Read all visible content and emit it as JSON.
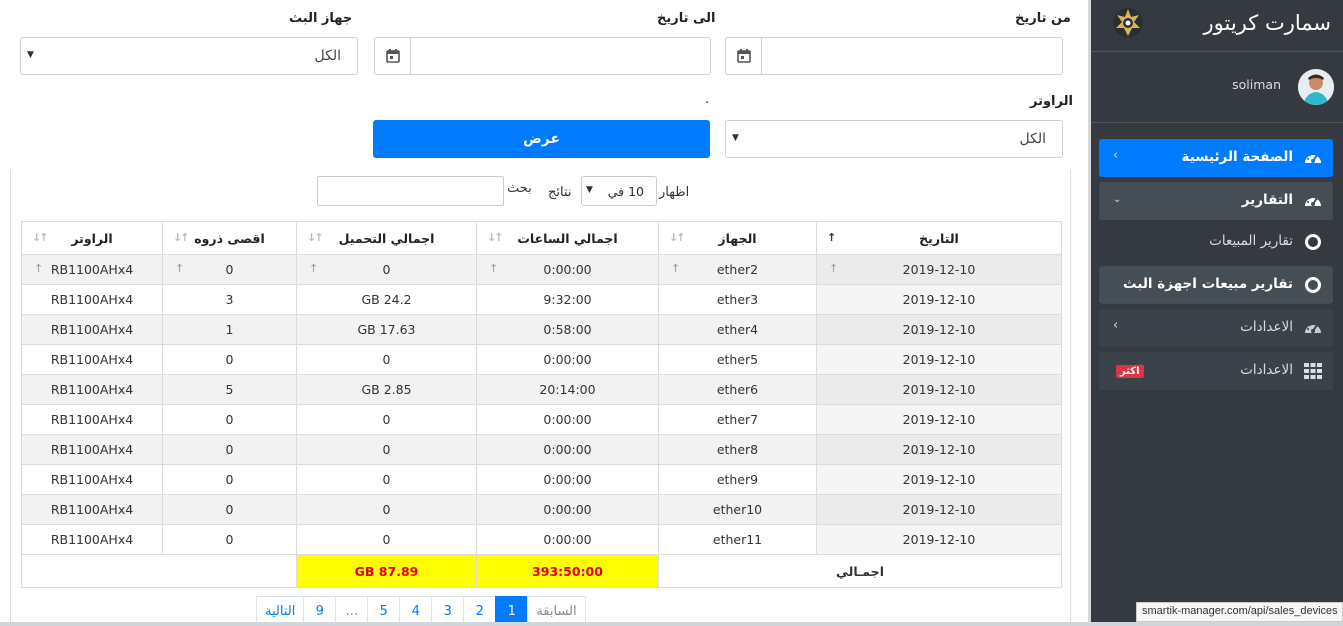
{
  "filters": {
    "from_date_label": "من تاريخ",
    "to_date_label": "الى تاريخ",
    "device_label": "جهاز البث",
    "device_value": "الكل",
    "router_label": "الراوتر",
    "router_value": "الكل",
    "dot": ".",
    "show_button": "عرض"
  },
  "table_controls": {
    "show_label": "اظهار",
    "length_value": "10 في",
    "results_label": "نتائج",
    "search_label": "بحث"
  },
  "table": {
    "columns": [
      "التاريخ",
      "الجهاز",
      "اجمالي الساعات",
      "اجمالي التحميل",
      "اقصى ذروه",
      "الراوتر"
    ],
    "rows": [
      [
        "2019-12-10",
        "ether2",
        "0:00:00",
        "0",
        "0",
        "RB1100AHx4"
      ],
      [
        "2019-12-10",
        "ether3",
        "9:32:00",
        "GB 24.2",
        "3",
        "RB1100AHx4"
      ],
      [
        "2019-12-10",
        "ether4",
        "0:58:00",
        "GB 17.63",
        "1",
        "RB1100AHx4"
      ],
      [
        "2019-12-10",
        "ether5",
        "0:00:00",
        "0",
        "0",
        "RB1100AHx4"
      ],
      [
        "2019-12-10",
        "ether6",
        "20:14:00",
        "GB 2.85",
        "5",
        "RB1100AHx4"
      ],
      [
        "2019-12-10",
        "ether7",
        "0:00:00",
        "0",
        "0",
        "RB1100AHx4"
      ],
      [
        "2019-12-10",
        "ether8",
        "0:00:00",
        "0",
        "0",
        "RB1100AHx4"
      ],
      [
        "2019-12-10",
        "ether9",
        "0:00:00",
        "0",
        "0",
        "RB1100AHx4"
      ],
      [
        "2019-12-10",
        "ether10",
        "0:00:00",
        "0",
        "0",
        "RB1100AHx4"
      ],
      [
        "2019-12-10",
        "ether11",
        "0:00:00",
        "0",
        "0",
        "RB1100AHx4"
      ]
    ],
    "footer": {
      "label": "اجمـالي",
      "total_hours": "393:50:00",
      "total_download": "GB 87.89"
    }
  },
  "pagination": {
    "prev": "السابقة",
    "pages": [
      "1",
      "2",
      "3",
      "4",
      "5",
      "...",
      "9"
    ],
    "next": "التالية",
    "active_page": "1"
  },
  "sidebar": {
    "brand": "سمارت كريتور",
    "user_name": "soliman",
    "items": {
      "home": "الصفحة الرئيسية",
      "reports": "التقارير",
      "sales_reports": "تقارير المبيعات",
      "device_sales_reports": "تقارير مبيعات اجهزة البث",
      "settings": "الاعدادات",
      "settings2": "الاعدادات",
      "badge": "اكثر"
    }
  },
  "status_url": "smartik-manager.com/api/sales_devices",
  "colors": {
    "primary": "#007bff",
    "sidebar": "#343a40",
    "highlight": "#ffff00",
    "danger": "#dc3545"
  }
}
